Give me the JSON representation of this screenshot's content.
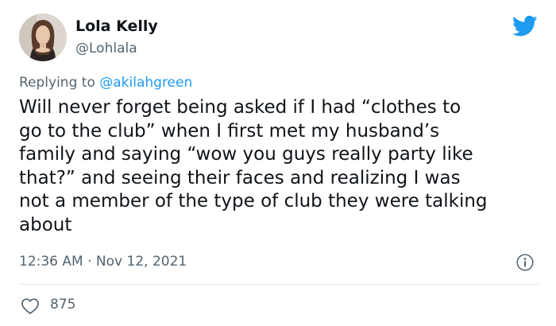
{
  "author": {
    "name": "Lola Kelly",
    "handle": "@Lohlala",
    "avatar_icon": "profile-photo"
  },
  "brand": {
    "icon": "twitter-bird-icon",
    "color": "#1d9bf0"
  },
  "reply": {
    "prefix": "Replying to ",
    "mention": "@akilahgreen"
  },
  "tweet": {
    "lines": [
      "Will never forget being asked if I had “clothes to",
      "go to the club” when I first met my husband’s",
      "family and saying “wow you guys really party like",
      "that?” and seeing their faces and realizing I was",
      "not a member of the type of club they were talking",
      "about"
    ]
  },
  "meta": {
    "time": "12:36 AM",
    "separator": " · ",
    "date": "Nov 12, 2021",
    "info_icon": "info-icon"
  },
  "actions": {
    "like_icon": "heart-icon",
    "like_count": "875"
  }
}
